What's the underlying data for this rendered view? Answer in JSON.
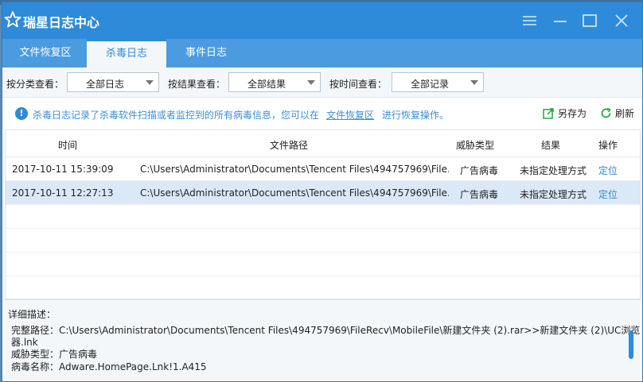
{
  "window": {
    "title": "瑞星日志中心",
    "accent_color": "#2e8bd9",
    "controls": [
      "list-icon",
      "minimize-icon",
      "maximize-icon",
      "close-icon"
    ]
  },
  "tabs": [
    {
      "label": "文件恢复区",
      "active": false
    },
    {
      "label": "杀毒日志",
      "active": true
    },
    {
      "label": "事件日志",
      "active": false
    }
  ],
  "filters": {
    "category": {
      "label": "按分类查看：",
      "value": "全部日志"
    },
    "result": {
      "label": "按结果查看：",
      "value": "全部结果"
    },
    "time": {
      "label": "按时间查看：",
      "value": "全部记录"
    }
  },
  "info": {
    "text_before": "杀毒日志记录了杀毒软件扫描或者监控到的所有病毒信息，您可以在",
    "link": "文件恢复区",
    "text_after": "进行恢复操作。"
  },
  "actions": {
    "save_as": "另存为",
    "refresh": "刷新"
  },
  "table": {
    "columns": [
      "时间",
      "文件路径",
      "威胁类型",
      "结果",
      "操作"
    ],
    "rows": [
      {
        "time": "2017-10-11 15:39:09",
        "path": "C:\\Users\\Administrator\\Documents\\Tencent Files\\494757969\\File...",
        "threat": "广告病毒",
        "result": "未指定处理方式",
        "action": "定位",
        "selected": false
      },
      {
        "time": "2017-10-11 12:27:13",
        "path": "C:\\Users\\Administrator\\Documents\\Tencent Files\\494757969\\File...",
        "threat": "广告病毒",
        "result": "未指定处理方式",
        "action": "定位",
        "selected": true
      }
    ]
  },
  "detail": {
    "title": "详细描述：",
    "full_path_line1": "完整路径：C:\\Users\\Administrator\\Documents\\Tencent Files\\494757969\\FileRecv\\MobileFile\\新建文件夹 (2).rar>>新建文件夹 (2)\\UC浏览",
    "full_path_line2": "器.lnk",
    "threat_type": "威胁类型：广告病毒",
    "virus_name": "病毒名称：Adware.HomePage.Lnk!1.A415"
  }
}
